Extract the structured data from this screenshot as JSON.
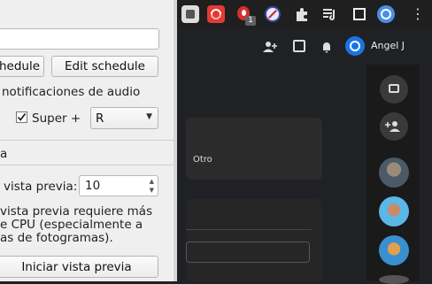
{
  "settings": {
    "edit_schedule_label": "Edit schedule",
    "schedule_label_fragment": "chedule",
    "audio_notifications_label": "notificaciones de audio",
    "shortcut": {
      "modifier_label": "Super +",
      "key_value": "R",
      "checked": true
    },
    "section_fragment": "a",
    "preview_frames_label": "vista previa:",
    "preview_frames_value": "10",
    "warning_lines": [
      "vista previa requiere más",
      "e CPU (especialmente a",
      "as de fotogramas)."
    ],
    "start_preview_label": "Iniciar vista previa"
  },
  "browser": {
    "badge_count": "1",
    "extensions": [
      "red-square-icon",
      "red-puzzle-icon",
      "shield-icon",
      "no-sign-icon",
      "puzzle-icon",
      "playlist-icon",
      "window-icon",
      "profile-icon",
      "more-vert-icon"
    ]
  },
  "web": {
    "user_name": "Angel J",
    "card_label": "Otro",
    "accent": "#1a73e8"
  }
}
